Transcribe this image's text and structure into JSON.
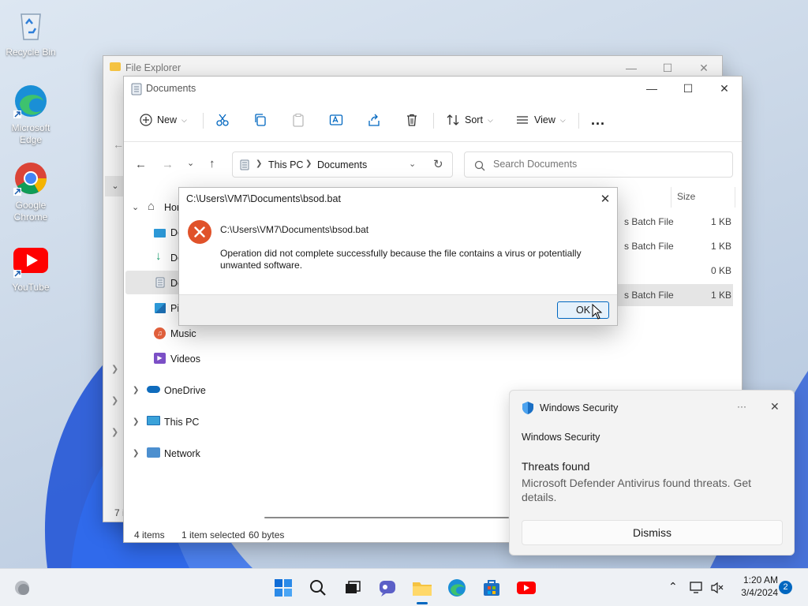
{
  "desktop": {
    "icons": [
      {
        "label": "Recycle Bin"
      },
      {
        "label": "Microsoft Edge"
      },
      {
        "label": "Google Chrome"
      },
      {
        "label": "YouTube"
      }
    ]
  },
  "back_window": {
    "title": "File Explorer",
    "status_left": "7 i"
  },
  "explorer": {
    "title": "Documents",
    "toolbar": {
      "new_label": "New",
      "sort_label": "Sort",
      "view_label": "View",
      "more_label": "..."
    },
    "breadcrumb": [
      "This PC",
      "Documents"
    ],
    "search": {
      "placeholder": "Search Documents"
    },
    "column_size": "Size",
    "nav": {
      "home": "Hor",
      "desktop": "De",
      "downloads": "Do",
      "documents": "Do",
      "pictures": "Pi",
      "music": "Music",
      "videos": "Videos",
      "onedrive": "OneDrive",
      "thispc": "This PC",
      "network": "Network"
    },
    "rows": [
      {
        "type": "s Batch File",
        "size": "1 KB"
      },
      {
        "type": "s Batch File",
        "size": "1 KB"
      },
      {
        "type": "",
        "size": "0 KB"
      },
      {
        "type": "s Batch File",
        "size": "1 KB"
      }
    ],
    "status": {
      "items": "4 items",
      "selected": "1 item selected",
      "bytes": "60 bytes"
    }
  },
  "dialog": {
    "title": "C:\\Users\\VM7\\Documents\\bsod.bat",
    "heading": "C:\\Users\\VM7\\Documents\\bsod.bat",
    "message": "Operation did not complete successfully because the file contains a virus or potentially unwanted software.",
    "ok_label": "OK"
  },
  "toast": {
    "app_name": "Windows Security",
    "more_label": "···",
    "header": "Windows Security",
    "title": "Threats found",
    "body": "Microsoft Defender Antivirus found threats. Get details.",
    "dismiss_label": "Dismiss"
  },
  "taskbar": {
    "time": "1:20 AM",
    "date": "3/4/2024",
    "notification_count": "2"
  },
  "colors": {
    "accent": "#0067c0",
    "error": "#e0522a",
    "selection": "#e5e5e5"
  }
}
